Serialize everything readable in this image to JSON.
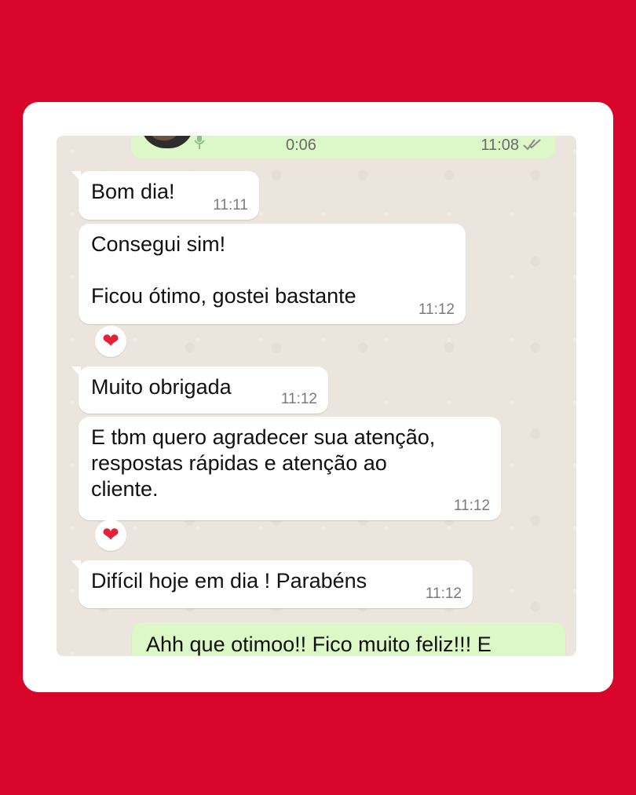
{
  "colors": {
    "background": "#d90429",
    "card": "#ffffff",
    "chat_background": "#ece5dd",
    "incoming_bubble": "#ffffff",
    "outgoing_bubble": "#dcf8c6",
    "reaction_heart": "#e3223a"
  },
  "voice_message": {
    "duration": "0:06",
    "time": "11:08",
    "status_icon": "double-check-icon"
  },
  "messages": [
    {
      "text": "Bom dia!",
      "time": "11:11"
    },
    {
      "text": "Consegui sim!\n\nFicou ótimo, gostei bastante",
      "time": "11:12"
    },
    {
      "text": "Muito obrigada",
      "time": "11:12"
    },
    {
      "text": "E tbm quero agradecer sua atenção,\nrespostas rápidas e atenção ao\ncliente.",
      "time": "11:12"
    },
    {
      "text": "Difícil hoje em dia ! Parabéns",
      "time": "11:12"
    }
  ],
  "reactions": [
    {
      "emoji": "❤"
    },
    {
      "emoji": "❤"
    }
  ],
  "outgoing_partial": {
    "text": "Ahh que otimoo!! Fico muito feliz!!! E"
  }
}
